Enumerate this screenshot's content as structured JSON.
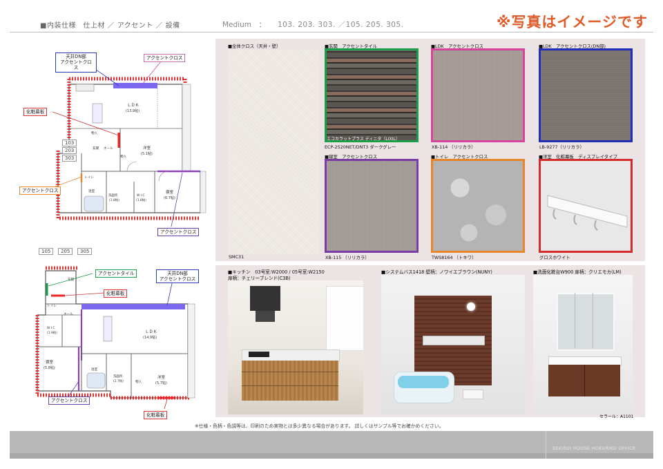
{
  "header": {
    "title": "■内装仕様　仕上材 ／ アクセント ／ 設備",
    "medium_label": "Medium　：",
    "units": "103. 203. 303. ／105. 205. 305.",
    "image_note": "※写真はイメージです"
  },
  "plan_top": {
    "unit_numbers": [
      "103",
      "203",
      "303"
    ],
    "room_labels": {
      "ldk": "ＬＤＫ",
      "ldk_area": "(13.9帖)",
      "western": "洋室",
      "western_area": "(5.1帖)",
      "bedroom": "寝室",
      "bedroom_area": "(6.7帖)",
      "entrance": "玄関",
      "hall": "ホール",
      "storage": "物入",
      "toilet": "トイレ",
      "bath": "浴室",
      "washroom": "洗面所",
      "washroom_area": "(1.8帖)",
      "wic": "W I C",
      "wic_area": "(1.8帖)"
    },
    "callouts": {
      "ceiling_dn": "天井DN部\nアクセントクロス",
      "accent_cloth_top": "アクセントクロス",
      "cosmetic_board": "化粧幕板",
      "accent_cloth_left": "アクセントクロス",
      "accent_cloth_bottom": "アクセントクロス"
    }
  },
  "plan_bottom": {
    "unit_numbers": [
      "105",
      "205",
      "305"
    ],
    "room_labels": {
      "ldk": "ＬＤＫ",
      "ldk_area": "(14.9帖)",
      "western": "洋室",
      "western_area": "(5.7帖)",
      "bedroom": "寝室",
      "bedroom_area": "(5.8帖)",
      "entrance": "玄関",
      "hall": "ホール",
      "toilet": "トイレ",
      "bath": "浴室",
      "washroom": "洗面所",
      "washroom_area": "(2.7帖)",
      "wic": "W I C",
      "wic_area": "(1.9帖)",
      "storage": "物入"
    },
    "callouts": {
      "accent_tile": "アクセントタイル",
      "ceiling_dn": "天井DN部\nアクセントクロス",
      "cosmetic_board_mid": "化粧幕板",
      "accent_cloth": "アクセントクロス",
      "cosmetic_board_bottom": "化粧幕板"
    }
  },
  "materials": {
    "overall": {
      "title": "■全体クロス（天井・壁）",
      "code": "SMC31"
    },
    "entrance": {
      "title": "■玄関　アクセントタイル",
      "overlay": "エコカラットプラス ディニタ（LIXIL）",
      "code": "ECP-2520NET/DNT3 ダークグレー",
      "frame": "#1a9e4a"
    },
    "ldk": {
      "title": "■LDK　アクセントクロス",
      "code": "XB-114 （リリカラ）",
      "frame": "#d8439a"
    },
    "ldk_dn": {
      "title": "■LDK　アクセントクロス(DN部)",
      "code": "LB-9277（リリカラ）",
      "frame": "#1f2fb8"
    },
    "bedroom": {
      "title": "■寝室　アクセントクロス",
      "code": "XB-115 （リリカラ）",
      "frame": "#7a3ba6"
    },
    "toilet": {
      "title": "■トイレ　アクセントクロス",
      "code": "TWS8164 （トキワ）",
      "frame": "#e8842a"
    },
    "western": {
      "title": "■洋室　化粧幕板　ディスプレイタイプ",
      "code": "グロスホワイト",
      "frame": "#d42a2a"
    }
  },
  "equipment": {
    "kitchen": {
      "title": "■キッチン　03号室:W2000 / 05号室:W2150",
      "subtitle": "扉柄：チェリーブレンド(C3B)"
    },
    "bath": {
      "title": "■システムバス1418  壁柄：ノワイエブラウン(NUNY)"
    },
    "vanity": {
      "title": "■洗面化粧台W900  扉柄：クリエモカ(LM)",
      "maker": "セラール：A1101"
    }
  },
  "footer": {
    "note": "※仕様・色柄・色調等は、印刷のため実物とは多少異なる場合があります。 詳しくはサンプル等でお確かめください。",
    "company": "SEKISUI HOUSE HOKURIKU OFFICE"
  },
  "colors": {
    "accent_orange": "#e05a2a",
    "panel_bg": "#ebe3e4",
    "green": "#1a9e4a",
    "pink": "#d8439a",
    "blue": "#1f2fb8",
    "purple": "#7a3ba6",
    "orange": "#e8842a",
    "red": "#d42a2a"
  }
}
